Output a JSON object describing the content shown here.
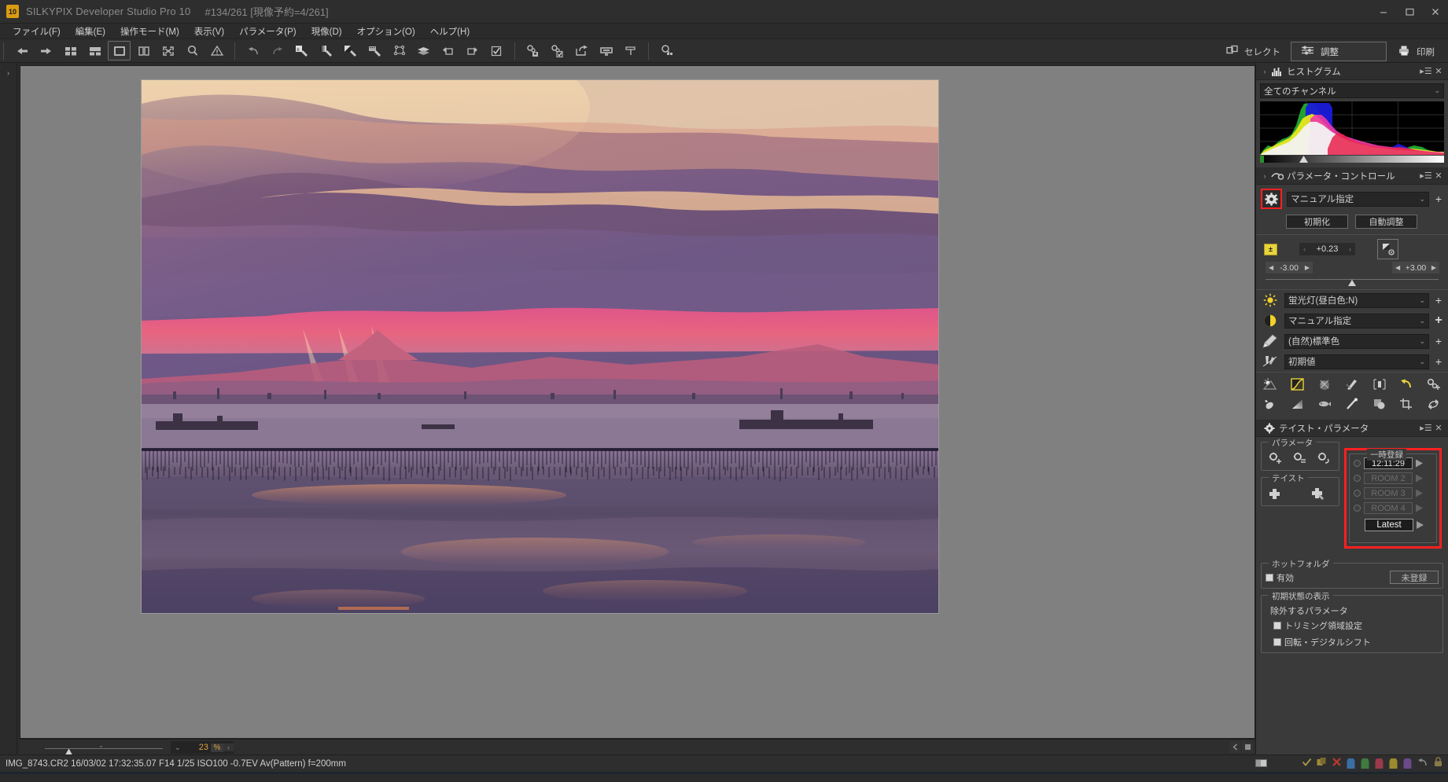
{
  "window": {
    "badge": "10",
    "title": "SILKYPIX Developer Studio Pro 10",
    "subtitle": "#134/261 [現像予約=4/261]",
    "minimize": "—",
    "maximize": "▢",
    "close": "✕"
  },
  "menubar": {
    "items": [
      {
        "label": "ファイル(F)",
        "name": "menu-file"
      },
      {
        "label": "編集(E)",
        "name": "menu-edit"
      },
      {
        "label": "操作モード(M)",
        "name": "menu-mode"
      },
      {
        "label": "表示(V)",
        "name": "menu-view"
      },
      {
        "label": "パラメータ(P)",
        "name": "menu-parameter"
      },
      {
        "label": "現像(D)",
        "name": "menu-develop"
      },
      {
        "label": "オプション(O)",
        "name": "menu-options"
      },
      {
        "label": "ヘルプ(H)",
        "name": "menu-help"
      }
    ]
  },
  "toolbar": {
    "icons": [
      "prev-image-icon",
      "next-image-icon",
      "thumbnail-grid-icon",
      "thumbnail-list-icon",
      "single-view-icon",
      "compare-view-icon",
      "fullscreen-icon",
      "magnifier-icon",
      "warning-icon",
      "undo-icon",
      "redo-icon",
      "exposure-tool-icon",
      "gradation-tool-icon",
      "contrast-tool-icon",
      "film-tool-icon",
      "spot-tool-icon",
      "layers-icon",
      "rotate-left-icon",
      "rotate-right-icon",
      "checkbox-icon",
      "save-params-icon",
      "apply-params-icon",
      "export-icon",
      "display-icon",
      "hammer-icon",
      "search-thumbs-icon"
    ],
    "modes": [
      {
        "label": "セレクト",
        "icon": "select-mode-icon",
        "selected": false
      },
      {
        "label": "調整",
        "icon": "adjust-mode-icon",
        "selected": true
      },
      {
        "label": "印刷",
        "icon": "print-mode-icon",
        "selected": false
      }
    ]
  },
  "viewer": {
    "zoom_value": "23",
    "zoom_unit": "%",
    "zoom_prev": "‹",
    "zoom_dropdown": "⌄"
  },
  "histogram": {
    "title": "ヒストグラム",
    "icon": "histogram-icon",
    "channel": "全てのチャンネル",
    "menu_btn": "▸☰",
    "close_btn": "✕",
    "collapse": "›"
  },
  "parameter_control": {
    "title": "パラメータ・コントロール",
    "icon": "parameter-control-icon",
    "menu_btn": "▸☰",
    "close_btn": "✕",
    "collapse": "›",
    "preset": "マニュアル指定",
    "gear_icon": "gear-icon",
    "add_icon": "+",
    "reset_label": "初期化",
    "auto_label": "自動調整",
    "exposure": {
      "icon": "exposure-icon",
      "value": "+0.23",
      "min": "-3.00",
      "max": "+3.00",
      "left_arrow": "‹",
      "right_arrow": "›",
      "camera_icon": "exposure-camera-icon"
    },
    "rows": [
      {
        "icon": "white-balance-icon",
        "value": "蛍光灯(昼白色:N)",
        "name": "white-balance-combo"
      },
      {
        "icon": "tone-icon",
        "value": "マニュアル指定",
        "name": "tone-combo"
      },
      {
        "icon": "color-icon",
        "value": "(自然)標準色",
        "name": "color-combo"
      },
      {
        "icon": "sharpness-icon",
        "value": "初期値",
        "name": "sharpness-combo"
      }
    ],
    "tool_icons_row1": [
      "highlight-controller-icon",
      "tone-curve-icon",
      "dodge-burn-icon",
      "noise-reduction-icon",
      "lens-aberration-icon",
      "rotate-reset-icon",
      "more-params-icon"
    ],
    "tool_icons_row2": [
      "dust-removal-icon",
      "gradient-filter-icon",
      "fisheye-icon",
      "brush-icon",
      "sphere-shading-icon",
      "crop-icon",
      "digital-shift-icon"
    ]
  },
  "taste_parameter": {
    "title": "テイスト・パラメータ",
    "icon": "taste-gear-icon",
    "menu_btn": "▸☰",
    "close_btn": "✕",
    "parameter_group": {
      "legend": "パラメータ",
      "buttons": [
        "param-add-icon",
        "param-copy-icon",
        "param-revert-icon"
      ]
    },
    "taste_group": {
      "legend": "テイスト",
      "buttons": [
        "taste-add-icon",
        "taste-edit-icon"
      ]
    },
    "temp_register": {
      "legend": "一時登録",
      "highlighted": true,
      "slots": [
        {
          "label": "12:11:29",
          "enabled": true,
          "arrow": "▶"
        },
        {
          "label": "ROOM 2",
          "enabled": false,
          "arrow": "▶"
        },
        {
          "label": "ROOM 3",
          "enabled": false,
          "arrow": "▶"
        },
        {
          "label": "ROOM 4",
          "enabled": false,
          "arrow": "▶"
        }
      ],
      "latest_label": "Latest",
      "latest_arrow": "▶"
    },
    "hot_folder": {
      "legend": "ホットフォルダ",
      "enabled_label": "有効",
      "enabled_checked": false,
      "status": "未登録"
    },
    "initial_state": {
      "legend": "初期状態の表示",
      "sub_label": "除外するパラメータ",
      "options": [
        {
          "label": "トリミング領域設定",
          "checked": false
        },
        {
          "label": "回転・デジタルシフト",
          "checked": false
        }
      ]
    }
  },
  "statusbar": {
    "text": "IMG_8743.CR2 16/03/02 17:32:35.07 F14 1/25 ISO100 -0.7EV Av(Pattern) f=200mm",
    "tags": [
      {
        "name": "check-mark-icon",
        "color": "#b9a14a"
      },
      {
        "name": "copy-tag-icon",
        "color": "#a08a3c"
      },
      {
        "name": "cross-mark-icon",
        "color": "#c0392b"
      },
      {
        "name": "tag-blue-icon",
        "color": "#3a6ea5"
      },
      {
        "name": "tag-green-icon",
        "color": "#3f7a3f"
      },
      {
        "name": "tag-red-icon",
        "color": "#9b3a4a"
      },
      {
        "name": "tag-yellow-icon",
        "color": "#9b8a2e"
      },
      {
        "name": "tag-purple-icon",
        "color": "#6b4a8a"
      },
      {
        "name": "undo-tag-icon",
        "color": "#8a8a8a"
      },
      {
        "name": "lock-icon",
        "color": "#8a7a4a"
      }
    ],
    "monitor_icon": "monitor-icon"
  },
  "colors": {
    "accent": "#d9a441",
    "highlight_red": "#ff2020",
    "panel_bg": "#3a3a3a",
    "chrome_bg": "#2e2e2e"
  }
}
